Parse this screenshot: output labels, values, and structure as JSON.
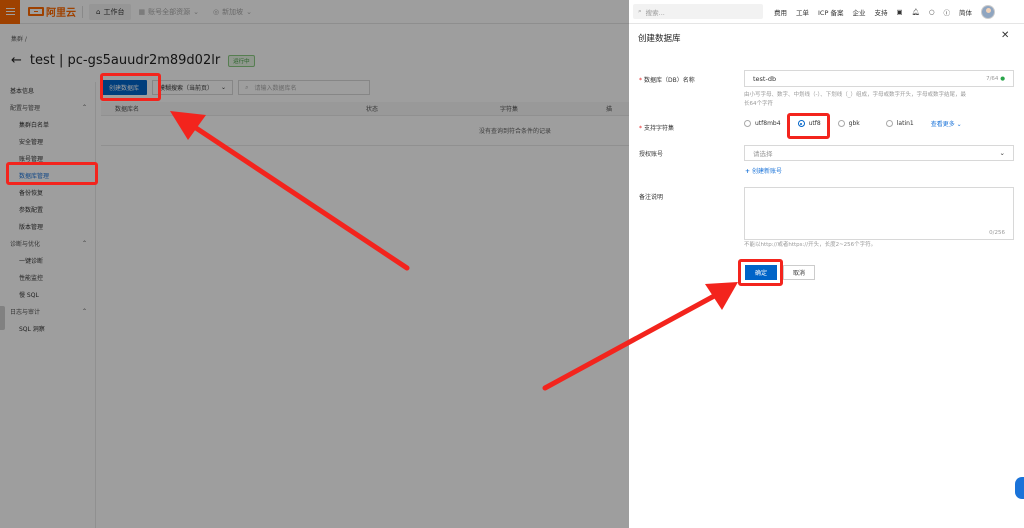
{
  "topbar": {
    "logo_text": "阿里云",
    "workbench": "工作台",
    "tab_account": "账号全部资源",
    "tab_region": "新加坡",
    "search_placeholder": "搜索...",
    "links": [
      "费用",
      "工单",
      "ICP 备案",
      "企业",
      "支持"
    ],
    "lang": "简体"
  },
  "main": {
    "breadcrumb": "集群 /",
    "title": "test | pc-gs5auudr2m89d02lr",
    "status": "运行中",
    "create_button": "创建数据库",
    "search_mode": "模糊搜索（当前页）",
    "search_placeholder": "请输入数据库名",
    "columns": [
      "数据库名",
      "状态",
      "字符集",
      "描"
    ],
    "empty_text": "没有查询到符合条件的记录"
  },
  "sidebar": {
    "items": [
      {
        "label": "基本信息",
        "type": "top"
      },
      {
        "label": "配置与管理",
        "type": "group"
      },
      {
        "label": "集群白名单",
        "type": "child"
      },
      {
        "label": "安全管理",
        "type": "child"
      },
      {
        "label": "账号管理",
        "type": "child"
      },
      {
        "label": "数据库管理",
        "type": "child-active"
      },
      {
        "label": "备份恢复",
        "type": "child"
      },
      {
        "label": "参数配置",
        "type": "child"
      },
      {
        "label": "版本管理",
        "type": "child"
      },
      {
        "label": "诊断与优化",
        "type": "group"
      },
      {
        "label": "一键诊断",
        "type": "child"
      },
      {
        "label": "性能监控",
        "type": "child"
      },
      {
        "label": "慢 SQL",
        "type": "child"
      },
      {
        "label": "日志与审计",
        "type": "group"
      },
      {
        "label": "SQL 洞察",
        "type": "child"
      }
    ]
  },
  "drawer": {
    "title": "创建数据库",
    "db_name_label": "数据库（DB）名称",
    "db_name_value": "test-db",
    "db_name_count": "7/64",
    "db_name_hint_1": "由小写字母、数字、中划线（-）、下划线（_）组成，字母或数字开头，字母或数字结尾，最",
    "db_name_hint_2": "长64个字符",
    "charset_label": "支持字符集",
    "charsets": [
      "utf8mb4",
      "utf8",
      "gbk",
      "latin1"
    ],
    "charset_selected": "utf8",
    "more_link": "查看更多",
    "account_label": "授权账号",
    "account_placeholder": "请选择",
    "create_account_link": "创建新账号",
    "remark_label": "备注说明",
    "remark_count": "0/256",
    "remark_hint": "不能以http://或者https://开头，长度2~256个字符。",
    "ok_button": "确定",
    "cancel_button": "取消"
  },
  "colors": {
    "primary": "#0064c8",
    "brand": "#ff6a00",
    "annotation": "#f3241d"
  }
}
